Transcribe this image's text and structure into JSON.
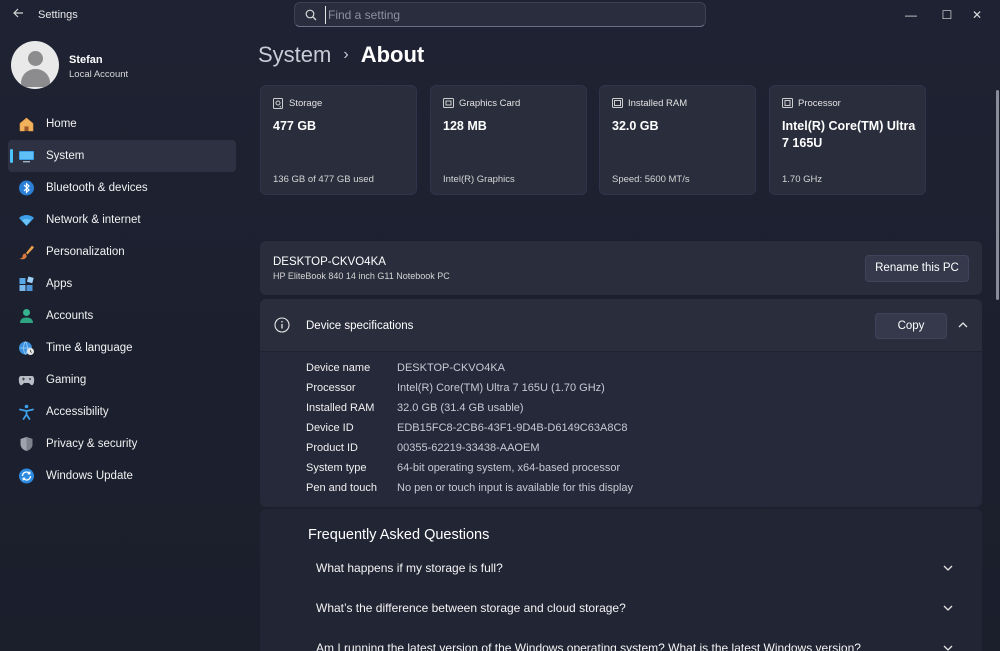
{
  "titlebar": {
    "app_title": "Settings",
    "search_placeholder": "Find a setting",
    "minimize": "—",
    "maximize": "☐",
    "close": "✕"
  },
  "profile": {
    "name": "Stefan",
    "account_type": "Local Account"
  },
  "sidebar": {
    "items": [
      {
        "label": "Home",
        "icon": "home-icon"
      },
      {
        "label": "System",
        "icon": "monitor-icon",
        "active": true
      },
      {
        "label": "Bluetooth & devices",
        "icon": "bluetooth-icon"
      },
      {
        "label": "Network & internet",
        "icon": "wifi-icon"
      },
      {
        "label": "Personalization",
        "icon": "brush-icon"
      },
      {
        "label": "Apps",
        "icon": "apps-icon"
      },
      {
        "label": "Accounts",
        "icon": "person-icon"
      },
      {
        "label": "Time & language",
        "icon": "globe-clock-icon"
      },
      {
        "label": "Gaming",
        "icon": "gamepad-icon"
      },
      {
        "label": "Accessibility",
        "icon": "accessibility-icon"
      },
      {
        "label": "Privacy & security",
        "icon": "shield-icon"
      },
      {
        "label": "Windows Update",
        "icon": "update-icon"
      }
    ]
  },
  "breadcrumb": {
    "parent": "System",
    "separator": "›",
    "current": "About"
  },
  "cards": [
    {
      "title": "Storage",
      "value": "477 GB",
      "sub": "136 GB of 477 GB used",
      "icon": "storage-icon"
    },
    {
      "title": "Graphics Card",
      "value": "128 MB",
      "sub": "Intel(R) Graphics",
      "icon": "graphics-card-icon"
    },
    {
      "title": "Installed RAM",
      "value": "32.0 GB",
      "sub": "Speed: 5600 MT/s",
      "icon": "ram-icon"
    },
    {
      "title": "Processor",
      "value": "Intel(R) Core(TM) Ultra 7 165U",
      "sub": "1.70 GHz",
      "icon": "processor-icon"
    }
  ],
  "pc": {
    "name": "DESKTOP-CKVO4KA",
    "model": "HP EliteBook 840 14 inch G11 Notebook PC",
    "rename_label": "Rename this PC"
  },
  "specs": {
    "title": "Device specifications",
    "copy_label": "Copy",
    "rows": [
      {
        "key": "Device name",
        "value": "DESKTOP-CKVO4KA"
      },
      {
        "key": "Processor",
        "value": "Intel(R) Core(TM) Ultra 7 165U (1.70 GHz)"
      },
      {
        "key": "Installed RAM",
        "value": "32.0 GB (31.4 GB usable)"
      },
      {
        "key": "Device ID",
        "value": "EDB15FC8-2CB6-43F1-9D4B-D6149C63A8C8"
      },
      {
        "key": "Product ID",
        "value": "00355-62219-33438-AAOEM"
      },
      {
        "key": "System type",
        "value": "64-bit operating system, x64-based processor"
      },
      {
        "key": "Pen and touch",
        "value": "No pen or touch input is available for this display"
      }
    ]
  },
  "faq": {
    "title": "Frequently Asked Questions",
    "questions": [
      "What happens if my storage is full?",
      "What’s the difference between storage and cloud storage?",
      "Am I running the latest version of the Windows operating system? What is the latest Windows version?"
    ]
  },
  "colors": {
    "accent": "#4cc2ff",
    "background": "#1c1f2e",
    "card": "#2a2d3c"
  }
}
